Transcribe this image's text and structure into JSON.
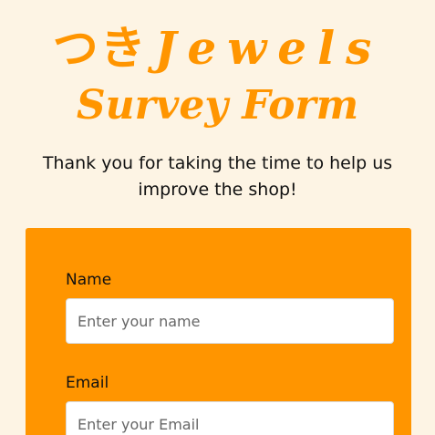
{
  "header": {
    "brand_jp": "つき",
    "brand_en": "Jewels",
    "subtitle": "Survey Form",
    "intro": "Thank you for taking the time to help us improve the shop!"
  },
  "form": {
    "name_label": "Name",
    "name_placeholder": "Enter your name",
    "email_label": "Email",
    "email_placeholder": "Enter your Email"
  },
  "colors": {
    "accent": "#ff9500",
    "background": "#fdf4e4"
  }
}
